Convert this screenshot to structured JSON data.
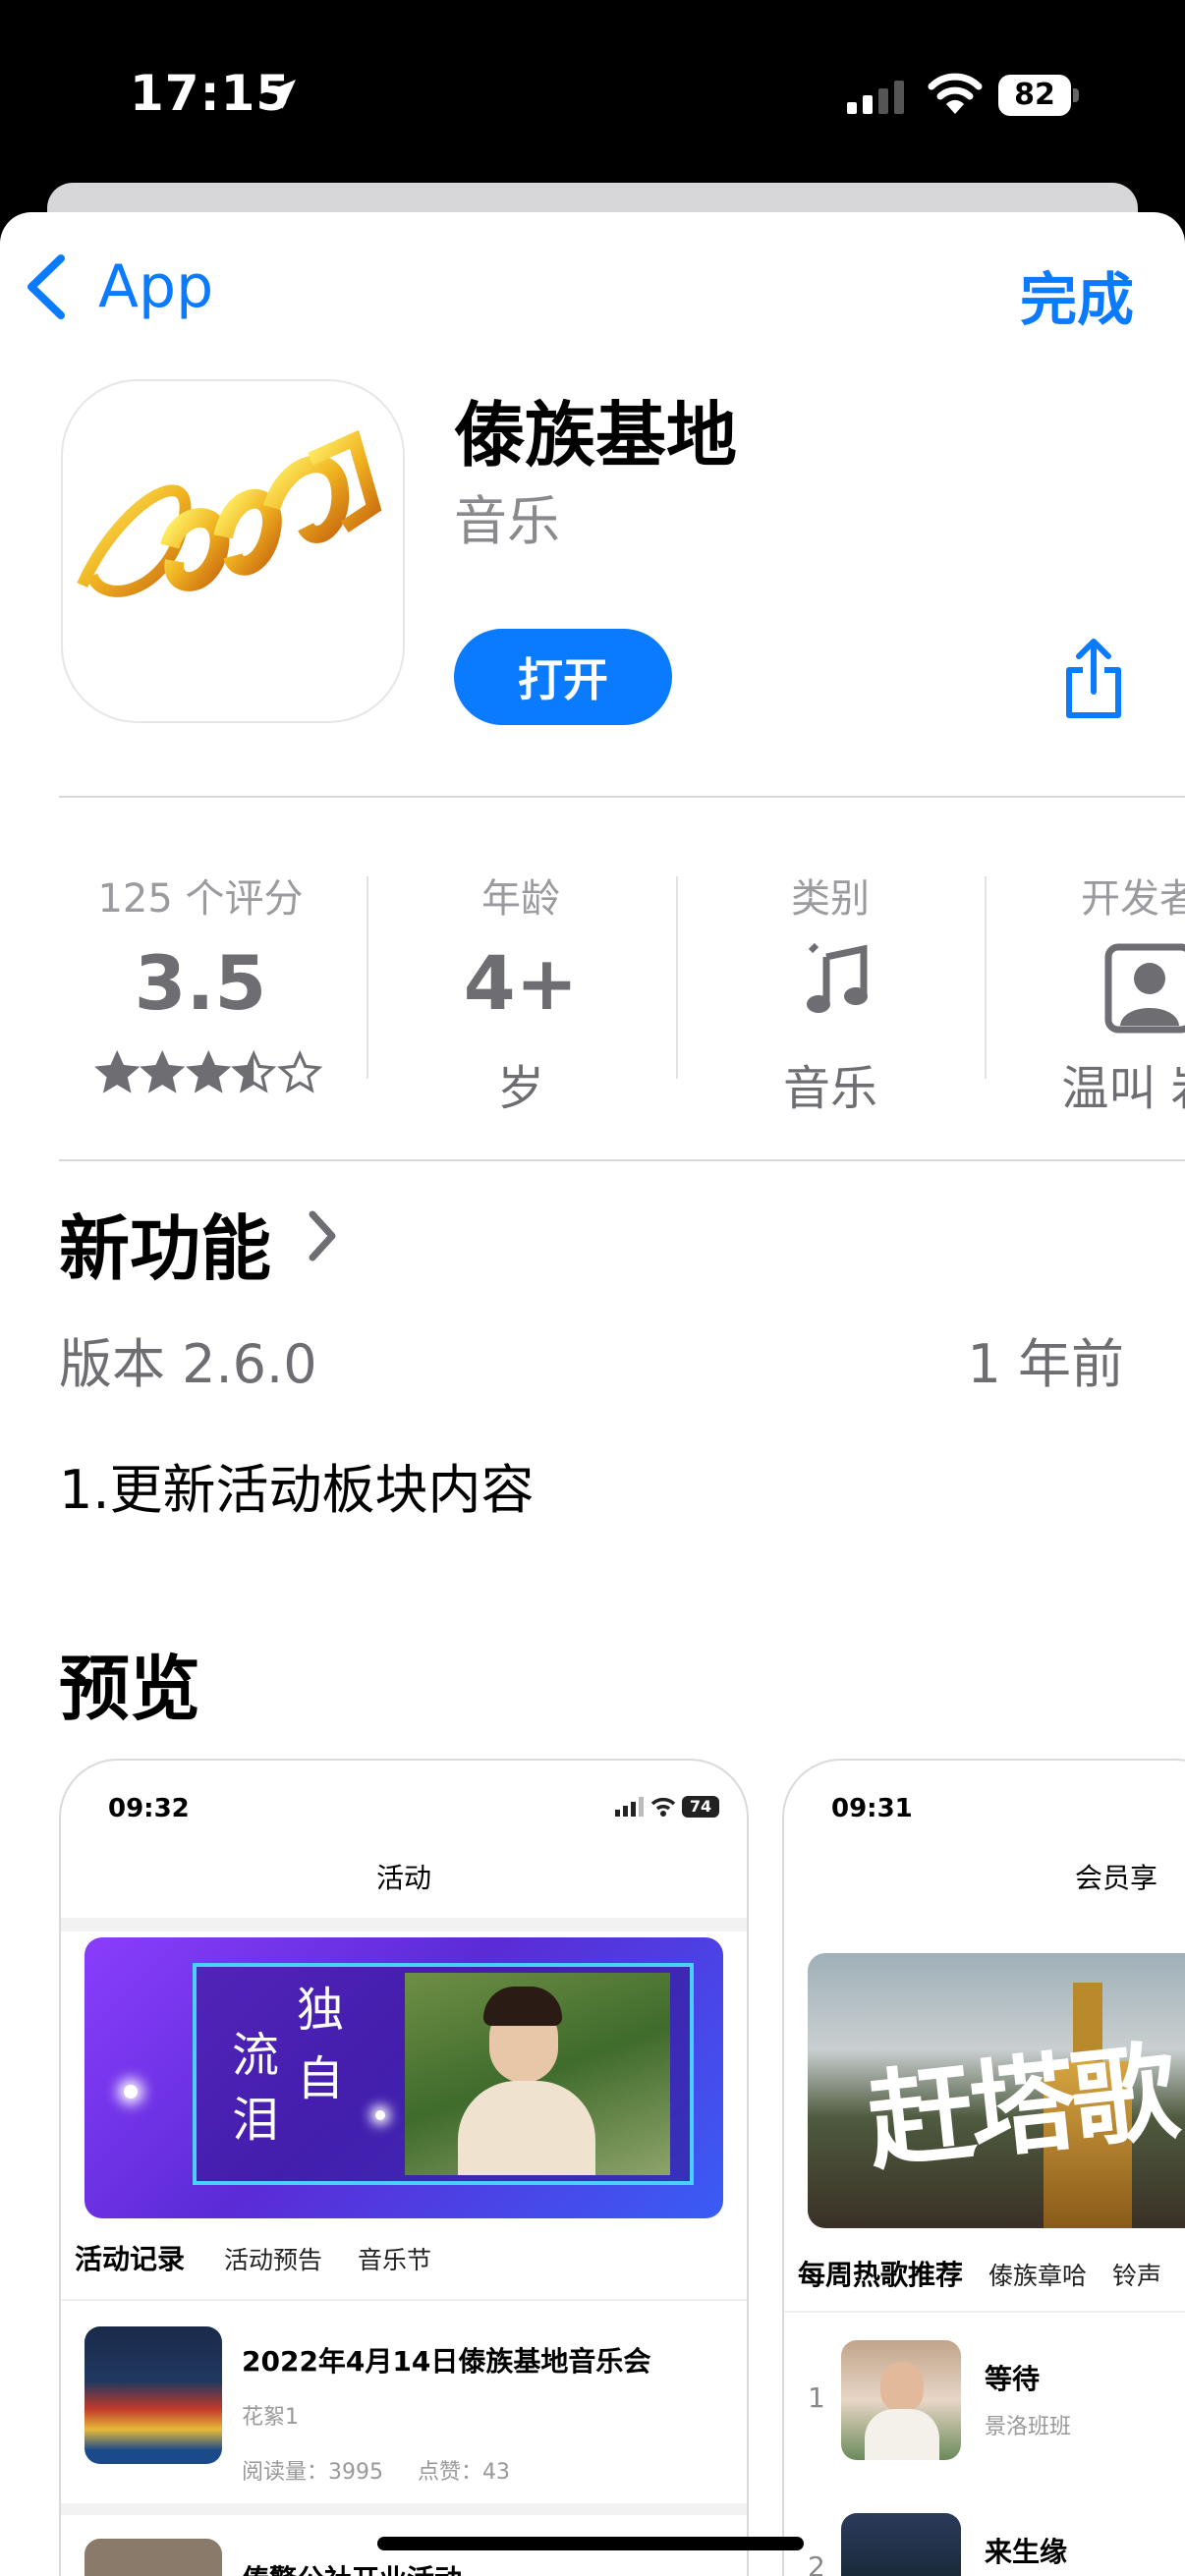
{
  "status_bar": {
    "time": "17:15",
    "battery": "82"
  },
  "nav": {
    "back_label": "App",
    "done_label": "完成"
  },
  "app": {
    "name": "傣族基地",
    "category": "音乐",
    "open_label": "打开"
  },
  "stats": {
    "ratings": {
      "label": "125 个评分",
      "value": "3.5",
      "rating": 3.5,
      "max": 5
    },
    "age": {
      "label": "年龄",
      "value": "4+",
      "sub": "岁"
    },
    "category": {
      "label": "类别",
      "sub": "音乐"
    },
    "developer": {
      "label": "开发者",
      "sub": "温叫 岩"
    }
  },
  "whats_new": {
    "heading": "新功能",
    "version": "版本 2.6.0",
    "date": "1 年前",
    "notes": "1.更新活动板块内容"
  },
  "preview": {
    "heading": "预览",
    "screens": [
      {
        "time": "09:32",
        "battery": "74",
        "title": "活动",
        "banner_text": [
          "独",
          "自",
          "流",
          "泪"
        ],
        "tabs": [
          "活动记录",
          "活动预告",
          "音乐节"
        ],
        "items": [
          {
            "title": "2022年4月14日傣族基地音乐会",
            "subtitle": "花絮1",
            "reads_label": "阅读量：",
            "reads": "3995",
            "likes_label": "点赞：",
            "likes": "43"
          },
          {
            "title": "傣警公社开业活动"
          }
        ]
      },
      {
        "time": "09:31",
        "title": "会员享",
        "banner_text": "赶塔歌",
        "tabs": [
          "每周热歌推荐",
          "傣族章哈",
          "铃声"
        ],
        "items": [
          {
            "rank": "1",
            "title": "等待",
            "subtitle": "景洛班班"
          },
          {
            "rank": "2",
            "title": "来生缘"
          }
        ]
      }
    ]
  },
  "colors": {
    "accent": "#0a7aff",
    "secondary_text": "#8a8a8e"
  }
}
